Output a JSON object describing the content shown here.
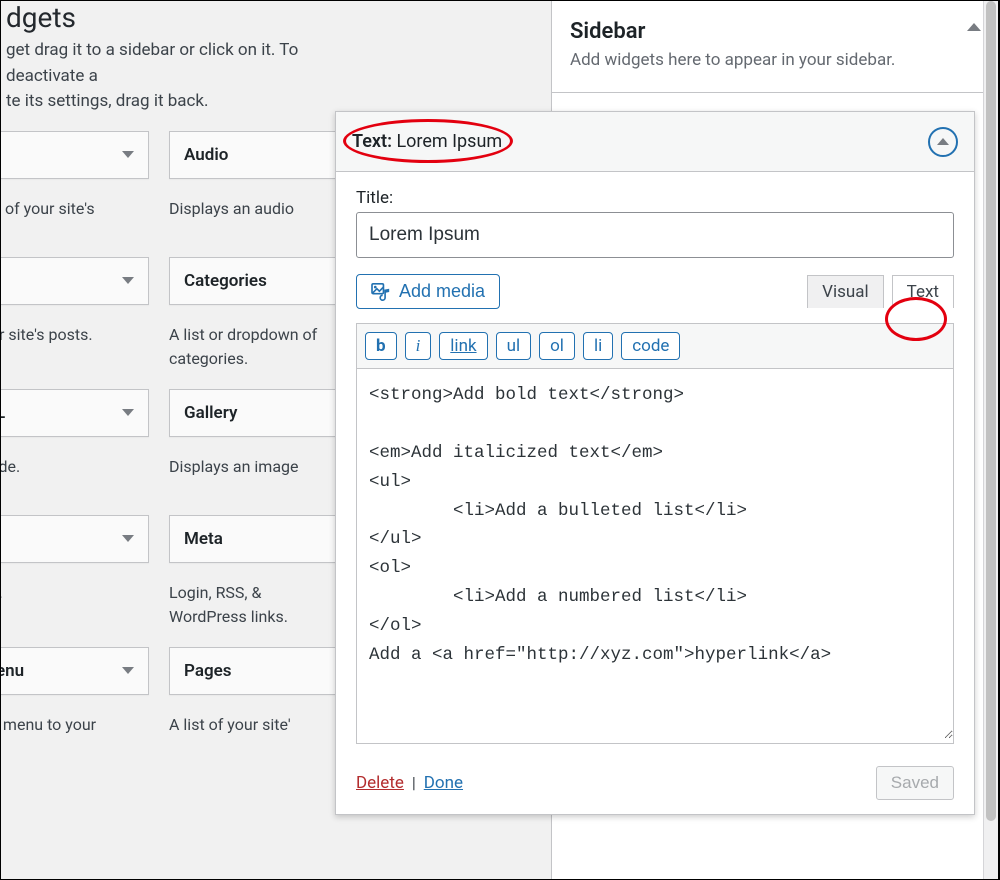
{
  "page": {
    "heading_fragment": "dgets",
    "desc_line1": "get drag it to a sidebar or click on it. To deactivate a",
    "desc_line2": "te its settings, drag it back."
  },
  "available_widgets": [
    {
      "title": "",
      "desc": "ive of your site's",
      "alt_title": "Audio",
      "alt_desc": "Displays an audio"
    },
    {
      "title": "",
      "desc": "our site's posts.",
      "alt_title": "Categories",
      "alt_desc": "A list or dropdown of categories."
    },
    {
      "title": "L",
      "desc": " code.",
      "alt_title": "Gallery",
      "alt_desc": "Displays an image"
    },
    {
      "title": "",
      "desc": "ge.",
      "alt_title": "Meta",
      "alt_desc": "Login, RSS, & WordPress links."
    },
    {
      "title": "enu",
      "desc": "on menu to your",
      "alt_title": "Pages",
      "alt_desc": "A list of your site'"
    }
  ],
  "sidebar": {
    "title": "Sidebar",
    "desc": "Add widgets here to appear in your sidebar."
  },
  "editor": {
    "type_label": "Text",
    "widget_name": "Lorem Ipsum",
    "title_label": "Title:",
    "title_value": "Lorem Ipsum",
    "add_media": "Add media",
    "tab_visual": "Visual",
    "tab_text": "Text",
    "toolbar": {
      "b": "b",
      "i": "i",
      "link": "link",
      "ul": "ul",
      "ol": "ol",
      "li": "li",
      "code": "code"
    },
    "content": "<strong>Add bold text</strong>\n\n<em>Add italicized text</em>\n<ul>\n \t<li>Add a bulleted list</li>\n</ul>\n<ol>\n \t<li>Add a numbered list</li>\n</ol>\nAdd a <a href=\"http://xyz.com\">hyperlink</a>",
    "delete": "Delete",
    "done": "Done",
    "saved": "Saved"
  }
}
